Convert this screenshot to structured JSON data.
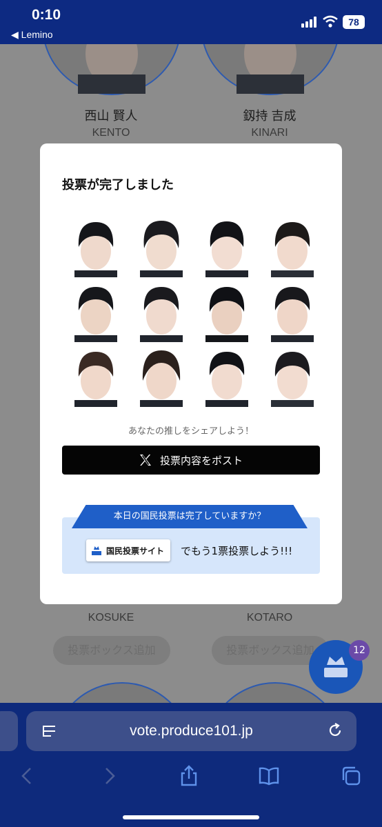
{
  "status_bar": {
    "time": "0:10",
    "back_label": "◀ Lemino",
    "battery": "78"
  },
  "background": {
    "top_cards": [
      {
        "name": "西山 賢人",
        "roman": "KENTO"
      },
      {
        "name": "釼持 吉成",
        "roman": "KINARI"
      }
    ],
    "bottom_cards": [
      {
        "roman": "KOSUKE",
        "add_label": "投票ボックス追加"
      },
      {
        "roman": "KOTARO",
        "add_label": "投票ボックス追加"
      }
    ],
    "badge_count": "12"
  },
  "modal": {
    "title": "投票が完了しました",
    "share_prompt": "あなたの推しをシェアしよう！",
    "post_button": "投票内容をポスト",
    "banner_head": "本日の国民投票は完了していますか？",
    "site_button": "国民投票サイト",
    "vote_once": "でもう1票投票しよう!!!"
  },
  "browser": {
    "url": "vote.produce101.jp"
  },
  "colors": {
    "accent": "#0d2a82",
    "banner": "#1f5fc8",
    "banner_bg": "#d6e6fb"
  }
}
